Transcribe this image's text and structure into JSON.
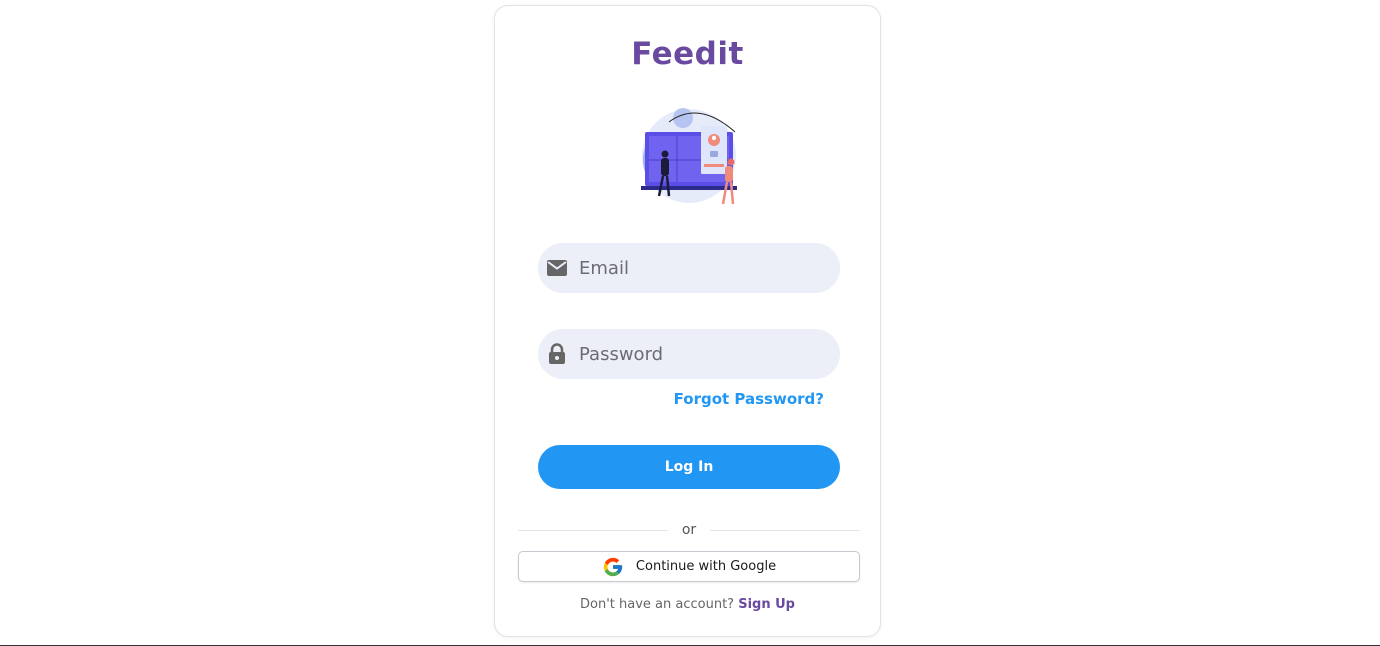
{
  "app": {
    "title": "Feedit"
  },
  "illustration": {
    "icon": "login-security-illustration"
  },
  "form": {
    "email": {
      "placeholder": "Email",
      "value": "",
      "icon": "mail-icon"
    },
    "password": {
      "placeholder": "Password",
      "value": "",
      "icon": "lock-icon"
    },
    "forgot_label": "Forgot Password?",
    "login_label": "Log In"
  },
  "divider": {
    "label": "or"
  },
  "google": {
    "label": "Continue with Google",
    "icon": "google-icon"
  },
  "signup": {
    "prompt": "Don't have an account?",
    "link_label": "Sign Up"
  },
  "colors": {
    "brand": "#6a4aa0",
    "accent": "#2196f3",
    "field_bg": "#eceff8"
  }
}
